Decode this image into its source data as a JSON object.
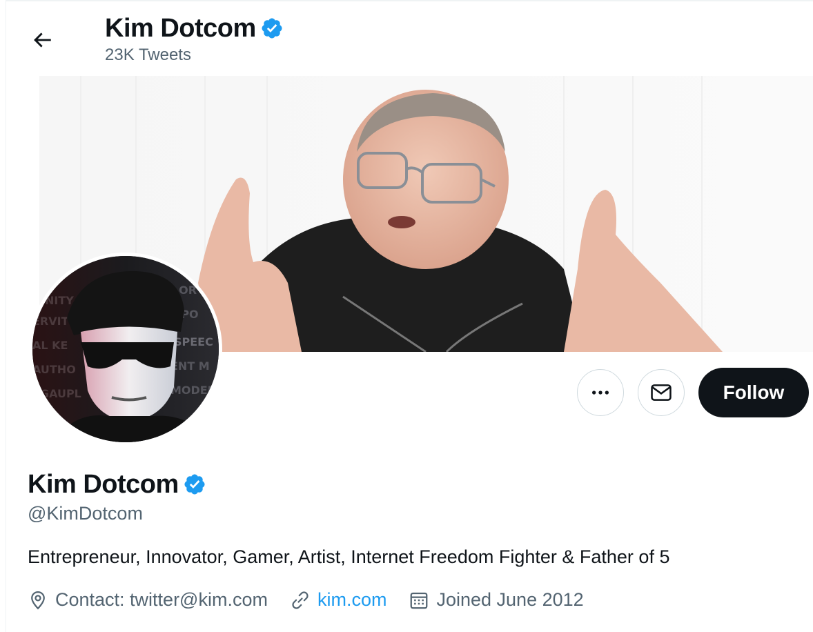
{
  "header": {
    "title": "Kim Dotcom",
    "tweet_count": "23K Tweets"
  },
  "actions": {
    "more": "more-icon",
    "message": "mail-icon",
    "follow_label": "Follow"
  },
  "profile": {
    "name": "Kim Dotcom",
    "handle": "@KimDotcom",
    "bio": "Entrepreneur, Innovator, Gamer, Artist, Internet Freedom Fighter & Father of 5",
    "location": "Contact: twitter@kim.com",
    "website": "kim.com",
    "joined": "Joined June 2012"
  },
  "colors": {
    "verified": "#1d9bf0",
    "link": "#1d9bf0",
    "follow_bg": "#0f1419",
    "secondary_text": "#536471"
  }
}
